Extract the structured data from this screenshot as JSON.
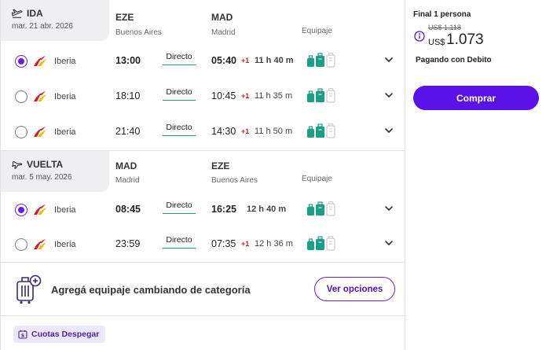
{
  "outbound": {
    "title": "IDA",
    "date": "mar. 21 abr. 2026",
    "origin_code": "EZE",
    "origin_city": "Buenos Aires",
    "dest_code": "MAD",
    "dest_city": "Madrid",
    "baggage_label": "Equipaje",
    "flights": [
      {
        "airline": "Iberia",
        "dep": "13:00",
        "stops": "Directo",
        "arr": "05:40",
        "plus": "+1",
        "duration": "11 h 40 m",
        "selected": true
      },
      {
        "airline": "Iberia",
        "dep": "18:10",
        "stops": "Directo",
        "arr": "10:45",
        "plus": "+1",
        "duration": "11 h 35 m",
        "selected": false
      },
      {
        "airline": "Iberia",
        "dep": "21:40",
        "stops": "Directo",
        "arr": "14:30",
        "plus": "+1",
        "duration": "11 h 50 m",
        "selected": false
      }
    ]
  },
  "inbound": {
    "title": "VUELTA",
    "date": "mar. 5 may. 2026",
    "origin_code": "MAD",
    "origin_city": "Madrid",
    "dest_code": "EZE",
    "dest_city": "Buenos Aires",
    "baggage_label": "Equipaje",
    "flights": [
      {
        "airline": "Iberia",
        "dep": "08:45",
        "stops": "Directo",
        "arr": "16:25",
        "plus": "",
        "duration": "12 h 40 m",
        "selected": true
      },
      {
        "airline": "Iberia",
        "dep": "23:59",
        "stops": "Directo",
        "arr": "07:35",
        "plus": "+1",
        "duration": "12 h 36 m",
        "selected": false
      }
    ]
  },
  "promo": {
    "text": "Agregá equipaje cambiando de categoría",
    "button": "Ver opciones"
  },
  "cuotas": {
    "label": "Cuotas Despegar"
  },
  "price": {
    "label": "Final 1 persona",
    "old": "US$ 1.118",
    "currency": "US$",
    "amount": "1.073",
    "payment": "Pagando con Debito",
    "buy": "Comprar"
  },
  "colors": {
    "accent": "#5b12e6",
    "baggage": "#1a9e86",
    "plus_day": "#c0262d",
    "iberia_red": "#d7192d",
    "iberia_yellow": "#f5b800"
  }
}
